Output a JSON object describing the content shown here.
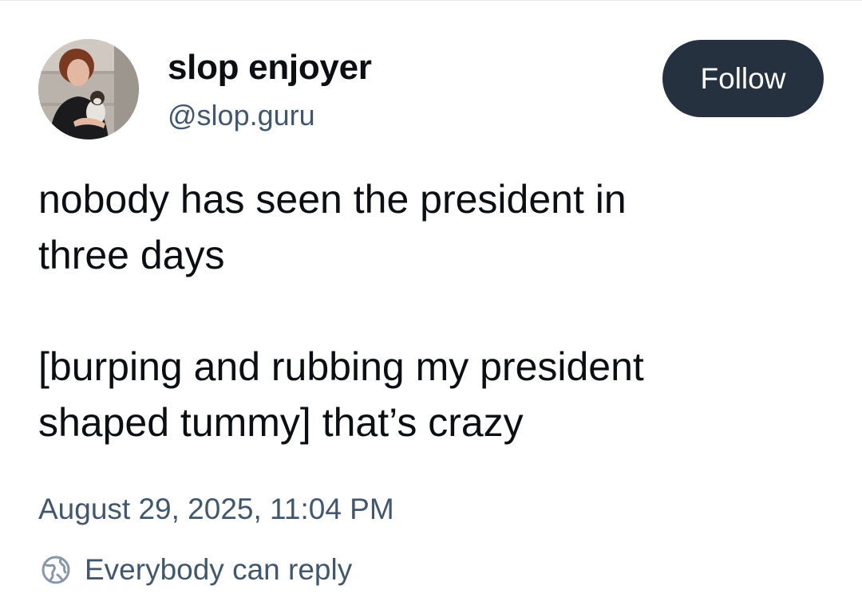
{
  "author": {
    "display_name": "slop enjoyer",
    "handle": "@slop.guru",
    "avatar_icon": "profile-photo"
  },
  "actions": {
    "follow_label": "Follow"
  },
  "post": {
    "paragraphs": [
      "nobody has seen the president in\nthree days",
      "[burping and rubbing my president\nshaped tummy] that’s crazy"
    ],
    "timestamp": "August 29, 2025, 11:04 PM",
    "reply_setting": "Everybody can reply",
    "reply_icon": "globe-icon"
  },
  "colors": {
    "follow_button_bg": "#26313f",
    "secondary_text": "#42576c",
    "primary_text": "#0b0f14"
  }
}
